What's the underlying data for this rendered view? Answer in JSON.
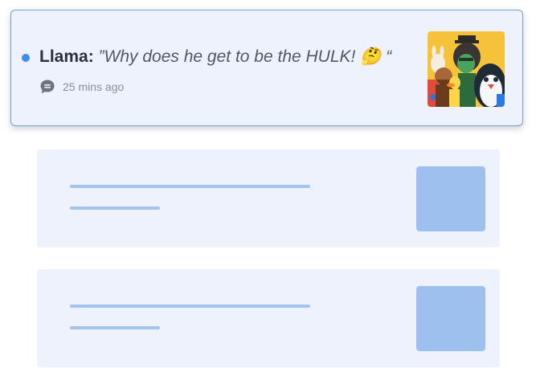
{
  "notification": {
    "sender": "Llama:",
    "message": "”Why does he get to be the HULK! 🤔 “",
    "timestamp": "25 mins ago",
    "unread": true,
    "thumbnail_icon": "cartoon-characters-group-image"
  },
  "skeleton_items": [
    {
      "state": "loading-placeholder"
    },
    {
      "state": "loading-placeholder"
    }
  ],
  "colors": {
    "card_background": "#edf2fc",
    "card_border": "#7c9fd8",
    "unread_dot": "#3d8ee8",
    "skeleton_line": "#a3c4ee",
    "skeleton_thumb": "#9dc0ee"
  }
}
